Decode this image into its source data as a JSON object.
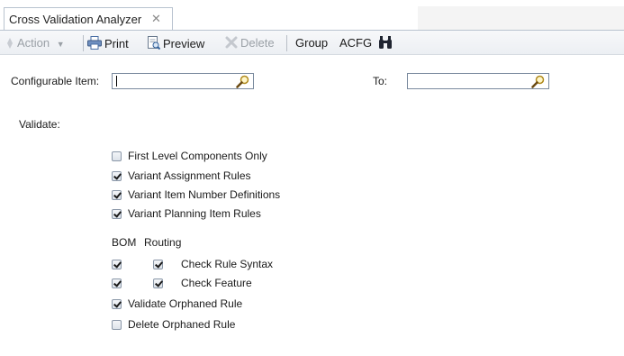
{
  "tab": {
    "title": "Cross Validation Analyzer",
    "close_glyph": "✕"
  },
  "toolbar": {
    "action_label": "Action",
    "print_label": "Print",
    "preview_label": "Preview",
    "delete_label": "Delete",
    "group_label": "Group",
    "acfg_label": "ACFG",
    "icons": [
      "action-icon",
      "dropdown-arrow-icon",
      "print-icon",
      "preview-icon",
      "delete-icon",
      "binoculars-icon"
    ]
  },
  "form": {
    "configurable_item_label": "Configurable Item:",
    "configurable_item_value": "",
    "to_label": "To:",
    "to_value": "",
    "validate_label": "Validate:"
  },
  "options": {
    "first_level": {
      "label": "First Level Components Only",
      "checked": false
    },
    "variant_assignment": {
      "label": "Variant Assignment Rules",
      "checked": true
    },
    "variant_item_number": {
      "label": "Variant Item Number Definitions",
      "checked": true
    },
    "variant_planning": {
      "label": "Variant Planning Item Rules",
      "checked": true
    }
  },
  "matrix": {
    "bom_header": "BOM",
    "routing_header": "Routing",
    "rows": [
      {
        "label": "Check Rule Syntax",
        "bom": true,
        "routing": true
      },
      {
        "label": "Check Feature",
        "bom": true,
        "routing": true
      }
    ]
  },
  "orphans": {
    "validate": {
      "label": "Validate Orphaned Rule",
      "checked": true
    },
    "delete": {
      "label": "Delete Orphaned Rule",
      "checked": false
    }
  },
  "colors": {
    "border": "#b9c3cf",
    "field_border": "#7a8a9e",
    "disabled_text": "#9aa0a6"
  }
}
